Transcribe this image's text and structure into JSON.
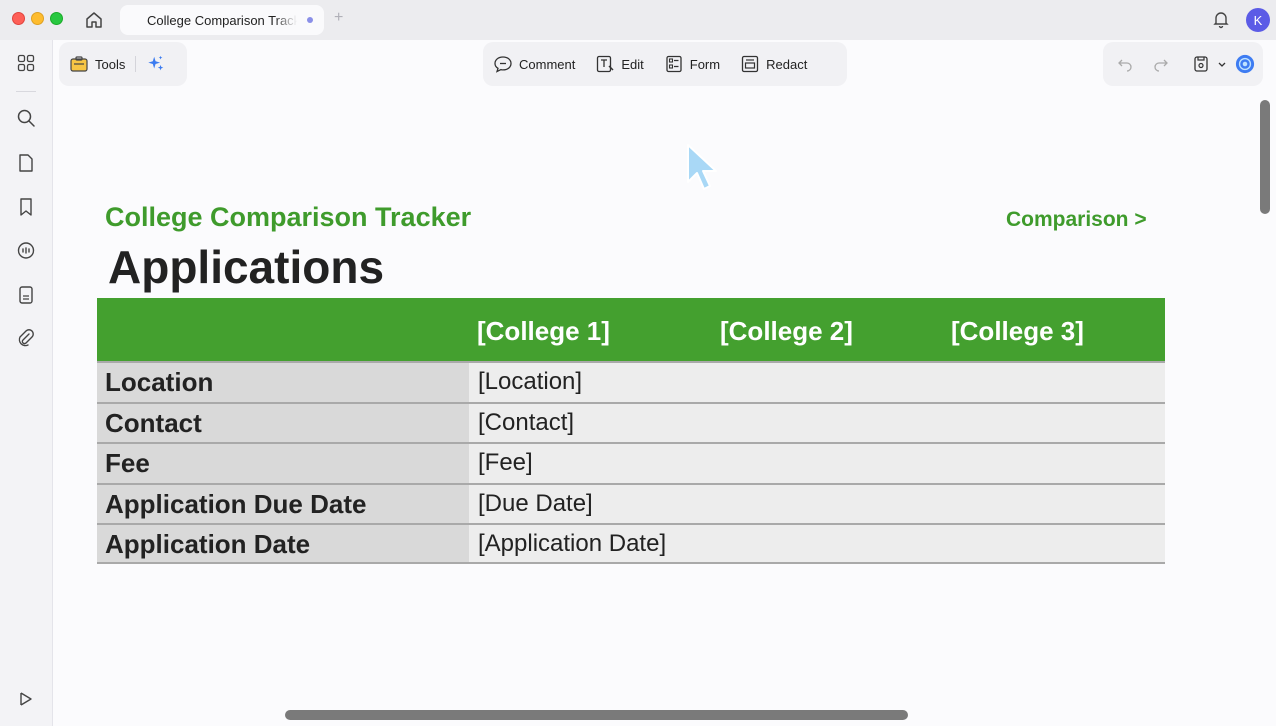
{
  "window": {
    "tab_title": "College Comparison Tracker",
    "avatar_initial": "K"
  },
  "toolbar": {
    "tools_label": "Tools",
    "comment_label": "Comment",
    "edit_label": "Edit",
    "form_label": "Form",
    "redact_label": "Redact"
  },
  "document": {
    "subtitle": "College Comparison Tracker",
    "link": "Comparison >",
    "title": "Applications",
    "columns": [
      "",
      "[College 1]",
      "[College 2]",
      "[College 3]"
    ],
    "rows": [
      {
        "label": "Location",
        "value": "[Location]"
      },
      {
        "label": "Contact",
        "value": "[Contact]"
      },
      {
        "label": "Fee",
        "value": "[Fee]"
      },
      {
        "label": "Application Due Date",
        "value": "[Due Date]"
      },
      {
        "label": "Application Date",
        "value": "[Application Date]"
      }
    ]
  },
  "colors": {
    "accent_green": "#44a02f",
    "label_bg": "#d9d9d9",
    "value_bg": "#ededed"
  }
}
